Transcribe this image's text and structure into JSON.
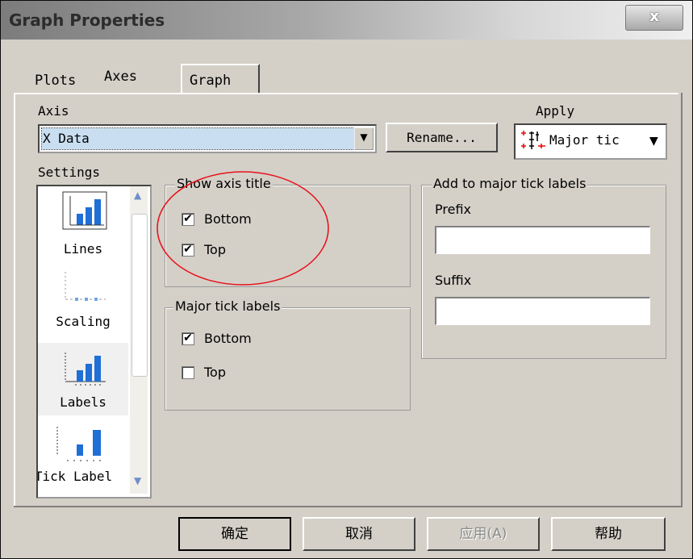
{
  "window": {
    "title": "Graph Properties",
    "close_label": "x"
  },
  "tabs": [
    {
      "label": "Plots"
    },
    {
      "label": "Axes"
    },
    {
      "label": "Graph"
    }
  ],
  "axis": {
    "label": "Axis",
    "value": "X Data",
    "rename_label": "Rename..."
  },
  "apply": {
    "label": "Apply",
    "value": "Major tic"
  },
  "settings": {
    "label": "Settings",
    "items": [
      {
        "label": "Lines"
      },
      {
        "label": "Scaling"
      },
      {
        "label": "Labels"
      },
      {
        "label": "Tick Label"
      }
    ]
  },
  "show_axis_title": {
    "legend": "Show axis title",
    "bottom": {
      "label": "Bottom",
      "checked": true
    },
    "top": {
      "label": "Top",
      "checked": true
    }
  },
  "major_tick_labels": {
    "legend": "Major tick labels",
    "bottom": {
      "label": "Bottom",
      "checked": true
    },
    "top": {
      "label": "Top",
      "checked": false
    }
  },
  "add_to_major": {
    "legend": "Add to major tick labels",
    "prefix_label": "Prefix",
    "prefix_value": "",
    "suffix_label": "Suffix",
    "suffix_value": ""
  },
  "buttons": {
    "ok": "确定",
    "cancel": "取消",
    "apply": "应用(A)",
    "help": "帮助"
  },
  "colors": {
    "annotation_circle": "#e8101a",
    "selection": "#c9dff1",
    "chart_bar": "#1f6fd6"
  },
  "icons": [
    "lines-settings-icon",
    "scaling-settings-icon",
    "labels-settings-icon",
    "tick-labels-settings-icon",
    "major-tick-apply-icon",
    "dropdown-arrow-icon"
  ]
}
